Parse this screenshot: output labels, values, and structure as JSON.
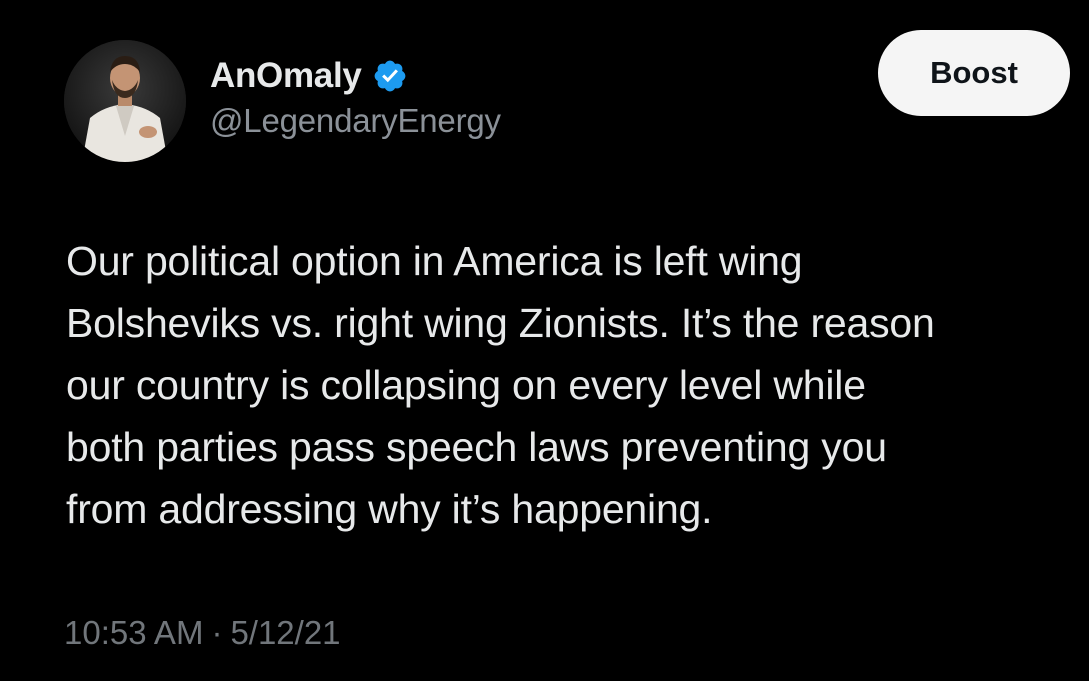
{
  "user": {
    "display_name": "AnOmaly",
    "handle": "@LegendaryEnergy",
    "verified": true,
    "verified_color": "#1d9bf0",
    "avatar_icon": "profile-avatar"
  },
  "actions": {
    "boost_label": "Boost"
  },
  "tweet": {
    "lines": [
      "Our political option in America is left wing",
      "Bolsheviks vs. right wing Zionists. It’s the reason",
      "our country is collapsing on every level while",
      "both parties pass speech laws preventing you",
      "from addressing why it’s happening."
    ],
    "time": "10:53 AM",
    "separator": "·",
    "date": "5/12/21"
  },
  "colors": {
    "background": "#000000",
    "text": "#e7e9ea",
    "muted": "#71767b",
    "button_bg": "#f5f5f5"
  }
}
